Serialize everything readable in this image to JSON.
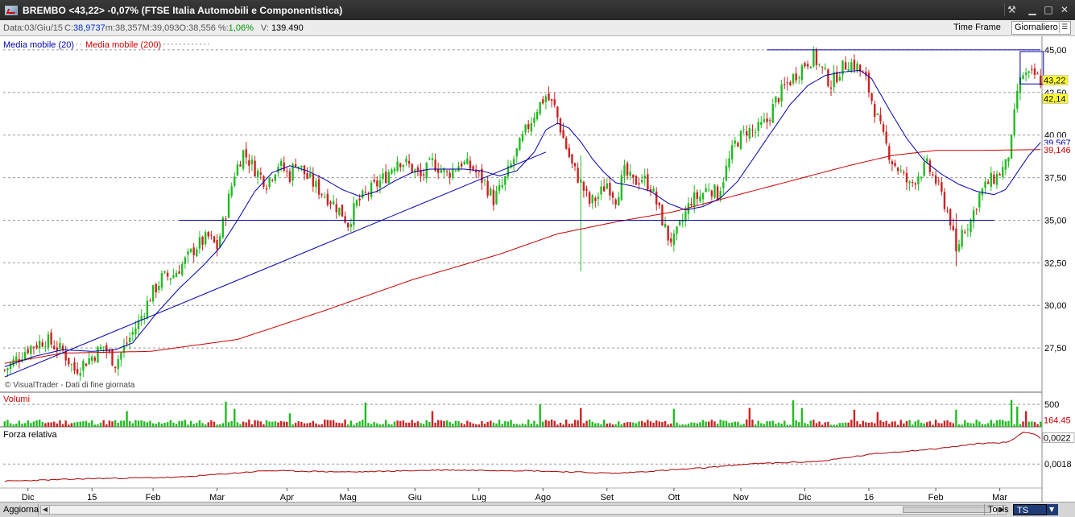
{
  "window": {
    "title": "BREMBO <43,22> -0,07%  (FTSE Italia Automobili e Componentistica)",
    "controls": [
      "⚒",
      "▁",
      "□",
      "✕"
    ]
  },
  "infobar": {
    "data_label": "Data:",
    "data_value": "03/Giu/15",
    "c_label": "C:",
    "c_value": "38,9737",
    "m_label": "m:",
    "m_value": "38,357",
    "M_label": "M:",
    "M_value": "39,093",
    "o_label": "O:",
    "o_value": "38,556",
    "pct_label": "%:",
    "pct_value": "1,06%",
    "v_label": "V:",
    "v_value": "139.490",
    "timeframe_label": "Time Frame",
    "timeframe_value": "Giornaliero"
  },
  "statusbar": {
    "aggiorna": "Aggiorna",
    "tools": "Tools",
    "ts": "TS OFF"
  },
  "colors": {
    "up": "#22bb22",
    "down": "#cc2222",
    "ma20": "#0000aa",
    "ma200": "#cc0000",
    "grid": "#9a9a9a"
  },
  "chart_data": [
    {
      "type": "candlestick",
      "panel": "price",
      "watermark": "© VisualTrader - Dati di fine giornata",
      "legend": [
        "Media mobile (20)",
        "Media mobile (200)"
      ],
      "ylim": [
        25.0,
        45.8
      ],
      "y_ticks": [
        "45,00",
        "42,50",
        "40,00",
        "37,50",
        "35,00",
        "32,50",
        "30,00",
        "27,50"
      ],
      "y_tick_values": [
        45.0,
        42.5,
        40.0,
        37.5,
        35.0,
        32.5,
        30.0,
        27.5
      ],
      "badges": [
        {
          "text": "43,22",
          "value": 43.22,
          "bg": "#ffff33",
          "fg": "#000000"
        },
        {
          "text": "42,14",
          "value": 42.14,
          "bg": "#ffff33",
          "fg": "#000000"
        },
        {
          "text": "39,567",
          "value": 39.567,
          "bg": "#ffffff",
          "fg": "#0000aa"
        },
        {
          "text": "39,146",
          "value": 39.146,
          "bg": "#ffffff",
          "fg": "#cc0000"
        }
      ],
      "x_labels": [
        "Dic",
        "15",
        "Feb",
        "Mar",
        "Apr",
        "Mag",
        "Giu",
        "Lug",
        "Ago",
        "Set",
        "Ott",
        "Nov",
        "Dic",
        "16",
        "Feb",
        "Mar"
      ],
      "x_label_index": [
        8,
        30,
        51,
        73,
        97,
        118,
        141,
        163,
        185,
        207,
        230,
        253,
        275,
        297,
        320,
        342
      ],
      "price_path": [
        [
          0,
          26.2
        ],
        [
          8,
          27.5
        ],
        [
          14,
          28.0
        ],
        [
          20,
          27.3
        ],
        [
          24,
          26.2
        ],
        [
          30,
          27.0
        ],
        [
          34,
          27.6
        ],
        [
          38,
          26.6
        ],
        [
          42,
          27.8
        ],
        [
          46,
          29.0
        ],
        [
          50,
          30.5
        ],
        [
          54,
          31.6
        ],
        [
          58,
          31.8
        ],
        [
          62,
          32.6
        ],
        [
          66,
          33.5
        ],
        [
          70,
          34.0
        ],
        [
          73,
          33.4
        ],
        [
          76,
          35.5
        ],
        [
          79,
          37.8
        ],
        [
          82,
          39.0
        ],
        [
          86,
          38.0
        ],
        [
          90,
          37.2
        ],
        [
          94,
          38.3
        ],
        [
          98,
          37.6
        ],
        [
          100,
          38.5
        ],
        [
          104,
          37.5
        ],
        [
          108,
          36.8
        ],
        [
          112,
          36.2
        ],
        [
          116,
          35.4
        ],
        [
          118,
          34.8
        ],
        [
          121,
          36.0
        ],
        [
          126,
          36.8
        ],
        [
          131,
          37.6
        ],
        [
          135,
          38.6
        ],
        [
          139,
          38.2
        ],
        [
          143,
          37.5
        ],
        [
          147,
          38.4
        ],
        [
          152,
          37.7
        ],
        [
          157,
          38.4
        ],
        [
          161,
          38.0
        ],
        [
          165,
          37.2
        ],
        [
          168,
          36.2
        ],
        [
          171,
          37.0
        ],
        [
          175,
          38.6
        ],
        [
          179,
          40.2
        ],
        [
          183,
          41.6
        ],
        [
          186,
          42.3
        ],
        [
          189,
          41.6
        ],
        [
          192,
          39.8
        ],
        [
          195,
          38.2
        ],
        [
          198,
          37.2
        ],
        [
          201,
          36.0
        ],
        [
          204,
          36.4
        ],
        [
          207,
          37.2
        ],
        [
          210,
          36.3
        ],
        [
          213,
          37.8
        ],
        [
          216,
          37.2
        ],
        [
          219,
          37.5
        ],
        [
          222,
          37.0
        ],
        [
          225,
          35.5
        ],
        [
          228,
          34.0
        ],
        [
          230,
          33.8
        ],
        [
          233,
          35.0
        ],
        [
          236,
          36.2
        ],
        [
          239,
          36.4
        ],
        [
          242,
          37.0
        ],
        [
          245,
          36.5
        ],
        [
          248,
          38.0
        ],
        [
          251,
          39.5
        ],
        [
          255,
          40.3
        ],
        [
          258,
          40.2
        ],
        [
          262,
          40.8
        ],
        [
          265,
          42.0
        ],
        [
          268,
          42.8
        ],
        [
          272,
          43.6
        ],
        [
          275,
          44.2
        ],
        [
          278,
          44.6
        ],
        [
          281,
          43.8
        ],
        [
          284,
          43.0
        ],
        [
          287,
          43.8
        ],
        [
          290,
          44.3
        ],
        [
          293,
          44.0
        ],
        [
          296,
          43.2
        ],
        [
          299,
          41.5
        ],
        [
          302,
          39.8
        ],
        [
          305,
          38.5
        ],
        [
          308,
          37.8
        ],
        [
          311,
          37.0
        ],
        [
          314,
          37.7
        ],
        [
          317,
          38.2
        ],
        [
          320,
          37.3
        ],
        [
          323,
          36.0
        ],
        [
          325,
          35.0
        ],
        [
          327,
          33.0
        ],
        [
          329,
          34.4
        ],
        [
          332,
          35.0
        ],
        [
          335,
          36.5
        ],
        [
          338,
          37.2
        ],
        [
          341,
          37.6
        ],
        [
          344,
          38.2
        ],
        [
          346,
          39.6
        ],
        [
          348,
          42.6
        ],
        [
          350,
          43.6
        ],
        [
          352,
          43.4
        ],
        [
          354,
          43.5
        ],
        [
          356,
          43.22
        ]
      ],
      "ma20_path": [
        [
          0,
          26.4
        ],
        [
          10,
          27.0
        ],
        [
          20,
          27.4
        ],
        [
          30,
          27.3
        ],
        [
          38,
          27.4
        ],
        [
          44,
          27.8
        ],
        [
          52,
          29.5
        ],
        [
          60,
          31.0
        ],
        [
          68,
          32.3
        ],
        [
          74,
          33.4
        ],
        [
          80,
          35.0
        ],
        [
          86,
          36.7
        ],
        [
          92,
          37.8
        ],
        [
          98,
          38.2
        ],
        [
          104,
          37.9
        ],
        [
          110,
          37.4
        ],
        [
          116,
          36.8
        ],
        [
          122,
          36.4
        ],
        [
          128,
          36.7
        ],
        [
          134,
          37.3
        ],
        [
          140,
          37.8
        ],
        [
          146,
          38.0
        ],
        [
          152,
          38.0
        ],
        [
          158,
          38.0
        ],
        [
          164,
          37.9
        ],
        [
          170,
          37.6
        ],
        [
          176,
          37.9
        ],
        [
          182,
          39.0
        ],
        [
          186,
          40.3
        ],
        [
          190,
          40.7
        ],
        [
          194,
          40.4
        ],
        [
          198,
          39.6
        ],
        [
          202,
          38.6
        ],
        [
          206,
          37.8
        ],
        [
          210,
          37.2
        ],
        [
          216,
          37.0
        ],
        [
          222,
          36.7
        ],
        [
          228,
          36.0
        ],
        [
          234,
          35.6
        ],
        [
          240,
          35.8
        ],
        [
          246,
          36.3
        ],
        [
          252,
          37.3
        ],
        [
          258,
          38.8
        ],
        [
          264,
          40.3
        ],
        [
          270,
          41.8
        ],
        [
          276,
          42.9
        ],
        [
          282,
          43.5
        ],
        [
          288,
          43.7
        ],
        [
          294,
          43.8
        ],
        [
          298,
          43.3
        ],
        [
          304,
          41.5
        ],
        [
          310,
          39.8
        ],
        [
          316,
          38.5
        ],
        [
          322,
          37.7
        ],
        [
          328,
          37.1
        ],
        [
          334,
          36.7
        ],
        [
          340,
          36.5
        ],
        [
          344,
          36.8
        ],
        [
          348,
          37.8
        ],
        [
          352,
          38.8
        ],
        [
          356,
          39.567
        ]
      ],
      "ma200_path": [
        [
          0,
          26.6
        ],
        [
          20,
          27.2
        ],
        [
          50,
          27.3
        ],
        [
          80,
          28.0
        ],
        [
          110,
          29.7
        ],
        [
          140,
          31.5
        ],
        [
          170,
          33.0
        ],
        [
          190,
          34.2
        ],
        [
          210,
          34.9
        ],
        [
          230,
          35.5
        ],
        [
          250,
          36.4
        ],
        [
          270,
          37.3
        ],
        [
          290,
          38.2
        ],
        [
          305,
          38.8
        ],
        [
          320,
          39.1
        ],
        [
          335,
          39.1
        ],
        [
          356,
          39.146
        ]
      ],
      "annotations": [
        {
          "kind": "trendline",
          "from": [
            0,
            25.8
          ],
          "to": [
            186,
            39.0
          ],
          "color": "#0000aa"
        },
        {
          "kind": "hline",
          "value": 35.0,
          "from": 60,
          "to": 340,
          "color": "#0000aa"
        },
        {
          "kind": "hline",
          "value": 45.0,
          "from": 262,
          "to": 356,
          "color": "#0000aa"
        },
        {
          "kind": "box",
          "x0": 349,
          "x1": 357,
          "y0": 44.9,
          "y1": 43.0,
          "color": "#0000aa"
        }
      ],
      "spikes": [
        {
          "i": 198,
          "low": 32.0,
          "high": 38.8
        },
        {
          "i": 327,
          "low": 32.3,
          "high": 35.4
        }
      ],
      "n_bars": 357
    },
    {
      "type": "bar",
      "panel": "volume",
      "label": "Volumi",
      "ylim": [
        0,
        700
      ],
      "y_ticks": [
        "500"
      ],
      "y_tick_values": [
        500
      ],
      "last_value_label": "164.45",
      "peaks": [
        {
          "i": 42,
          "v": 350
        },
        {
          "i": 76,
          "v": 560
        },
        {
          "i": 79,
          "v": 400
        },
        {
          "i": 98,
          "v": 300
        },
        {
          "i": 124,
          "v": 540
        },
        {
          "i": 147,
          "v": 350
        },
        {
          "i": 184,
          "v": 500
        },
        {
          "i": 198,
          "v": 420
        },
        {
          "i": 230,
          "v": 400
        },
        {
          "i": 256,
          "v": 420
        },
        {
          "i": 271,
          "v": 590
        },
        {
          "i": 274,
          "v": 420
        },
        {
          "i": 292,
          "v": 380
        },
        {
          "i": 300,
          "v": 330
        },
        {
          "i": 327,
          "v": 380
        },
        {
          "i": 346,
          "v": 600
        },
        {
          "i": 348,
          "v": 450
        },
        {
          "i": 351,
          "v": 350
        }
      ],
      "base_level": 110,
      "n_bars": 357
    },
    {
      "type": "line",
      "panel": "relative-strength",
      "label": "Forza relativa",
      "ylim": [
        0.00145,
        0.00235
      ],
      "y_ticks": [
        "0,0018"
      ],
      "y_tick_values": [
        0.0018
      ],
      "last_value_label": "0,0022",
      "path": [
        [
          0,
          0.00154
        ],
        [
          30,
          0.00158
        ],
        [
          60,
          0.0016
        ],
        [
          75,
          0.00165
        ],
        [
          90,
          0.0017
        ],
        [
          120,
          0.00168
        ],
        [
          150,
          0.00171
        ],
        [
          180,
          0.0017
        ],
        [
          210,
          0.00166
        ],
        [
          240,
          0.00174
        ],
        [
          255,
          0.0018
        ],
        [
          280,
          0.00184
        ],
        [
          300,
          0.00196
        ],
        [
          320,
          0.00203
        ],
        [
          335,
          0.00211
        ],
        [
          345,
          0.00213
        ],
        [
          350,
          0.00228
        ],
        [
          354,
          0.00226
        ],
        [
          356,
          0.00219
        ]
      ],
      "n_bars": 357
    }
  ]
}
